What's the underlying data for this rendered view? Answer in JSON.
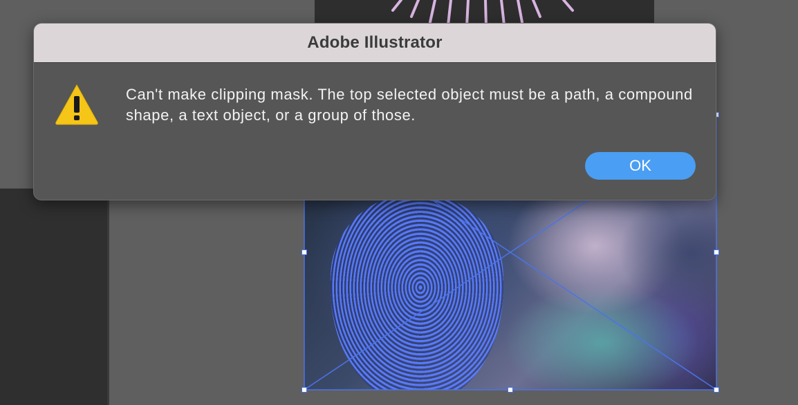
{
  "dialog": {
    "title": "Adobe Illustrator",
    "message": "Can't make clipping mask. The top selected object must be a path, a compound shape, a text object, or a group of those.",
    "ok_label": "OK",
    "icon": "warning-icon"
  },
  "colors": {
    "accent": "#4a9ef3",
    "selection": "#4a74e8",
    "warning": "#f5c518"
  }
}
